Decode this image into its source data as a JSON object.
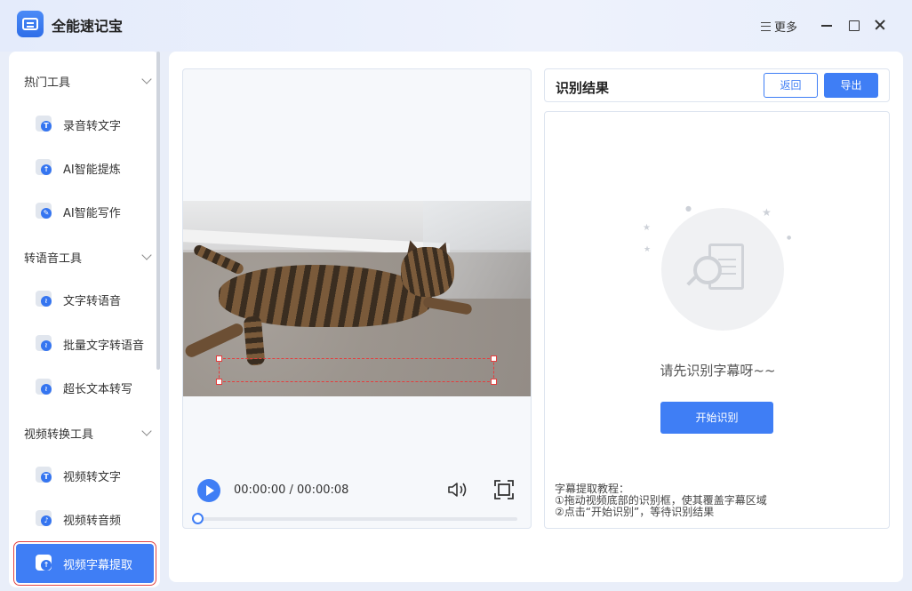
{
  "app": {
    "title": "全能速记宝"
  },
  "window": {
    "more_label": "更多"
  },
  "sidebar": {
    "groups": [
      {
        "label": "热门工具"
      },
      {
        "label": "转语音工具"
      },
      {
        "label": "视频转换工具"
      }
    ],
    "items": [
      {
        "label": "录音转文字",
        "icon": "text-t-icon"
      },
      {
        "label": "AI智能提炼",
        "icon": "upload-circle-icon"
      },
      {
        "label": "AI智能写作",
        "icon": "pen-icon"
      },
      {
        "label": "文字转语音",
        "icon": "audio-wave-icon"
      },
      {
        "label": "批量文字转语音",
        "icon": "audio-wave-icon"
      },
      {
        "label": "超长文本转写",
        "icon": "audio-wave-icon"
      },
      {
        "label": "视频转文字",
        "icon": "text-t-icon"
      },
      {
        "label": "视频转音频",
        "icon": "music-note-icon"
      },
      {
        "label": "视频字幕提取",
        "icon": "upload-circle-icon",
        "active": true
      }
    ]
  },
  "player": {
    "time_display": "00:00:00 / 00:00:08",
    "progress": 0.0
  },
  "result": {
    "title": "识别结果",
    "back_label": "返回",
    "export_label": "导出",
    "empty_text": "请先识别字幕呀~~",
    "start_label": "开始识别",
    "tutorial": {
      "heading": "字幕提取教程：",
      "step1": "①拖动视频底部的识别框，使其覆盖字幕区域",
      "step2": "②点击“开始识别”，等待识别结果"
    }
  },
  "colors": {
    "accent": "#3f7ef5",
    "selection_border": "#e53c3c"
  }
}
